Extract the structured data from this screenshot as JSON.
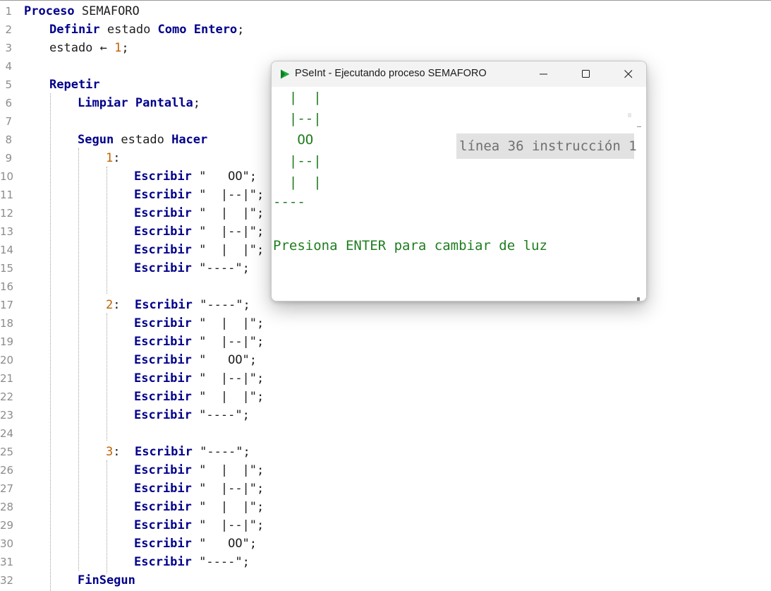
{
  "editor": {
    "lines": [
      {
        "n": "1",
        "text": "Proceso SEMAFORO"
      },
      {
        "n": "2",
        "text": "Definir estado Como Entero;"
      },
      {
        "n": "3",
        "text": "estado ← 1;"
      },
      {
        "n": "4",
        "text": ""
      },
      {
        "n": "5",
        "text": "Repetir"
      },
      {
        "n": "6",
        "text": "Limpiar Pantalla;"
      },
      {
        "n": "7",
        "text": ""
      },
      {
        "n": "8",
        "text": "Segun estado Hacer"
      },
      {
        "n": "9",
        "text": "1:"
      },
      {
        "n": "10",
        "text": "Escribir \"   OO\";"
      },
      {
        "n": "11",
        "text": "Escribir \"  |--|\";"
      },
      {
        "n": "12",
        "text": "Escribir \"  |  |\";"
      },
      {
        "n": "13",
        "text": "Escribir \"  |--|\";"
      },
      {
        "n": "14",
        "text": "Escribir \"  |  |\";"
      },
      {
        "n": "15",
        "text": "Escribir \"----\";"
      },
      {
        "n": "16",
        "text": ""
      },
      {
        "n": "17",
        "text": "2:  Escribir \"----\";"
      },
      {
        "n": "18",
        "text": "Escribir \"  |  |\";"
      },
      {
        "n": "19",
        "text": "Escribir \"  |--|\";"
      },
      {
        "n": "20",
        "text": "Escribir \"   OO\";"
      },
      {
        "n": "21",
        "text": "Escribir \"  |--|\";"
      },
      {
        "n": "22",
        "text": "Escribir \"  |  |\";"
      },
      {
        "n": "23",
        "text": "Escribir \"----\";"
      },
      {
        "n": "24",
        "text": ""
      },
      {
        "n": "25",
        "text": "3:  Escribir \"----\";"
      },
      {
        "n": "26",
        "text": "Escribir \"  |  |\";"
      },
      {
        "n": "27",
        "text": "Escribir \"  |--|\";"
      },
      {
        "n": "28",
        "text": "Escribir \"  |  |\";"
      },
      {
        "n": "29",
        "text": "Escribir \"  |--|\";"
      },
      {
        "n": "30",
        "text": "Escribir \"   OO\";"
      },
      {
        "n": "31",
        "text": "Escribir \"----\";"
      },
      {
        "n": "32",
        "text": "FinSegun"
      }
    ]
  },
  "run_window": {
    "title": "PSeInt - Ejecutando proceso SEMAFORO",
    "icon": "pseint-play-icon",
    "controls": [
      "minimize-icon",
      "maximize-icon",
      "close-icon"
    ],
    "console_lines": [
      "  |  |",
      "  |--|",
      "   OO",
      "  |--|",
      "  |  |",
      "----",
      "",
      "Presiona ENTER para cambiar de luz"
    ],
    "status": "línea 36 instrucción 1"
  },
  "colors": {
    "keyword": "#00008b",
    "number": "#c06000",
    "console_text": "#1e7d1e",
    "status_bg": "#e2e2e2"
  }
}
